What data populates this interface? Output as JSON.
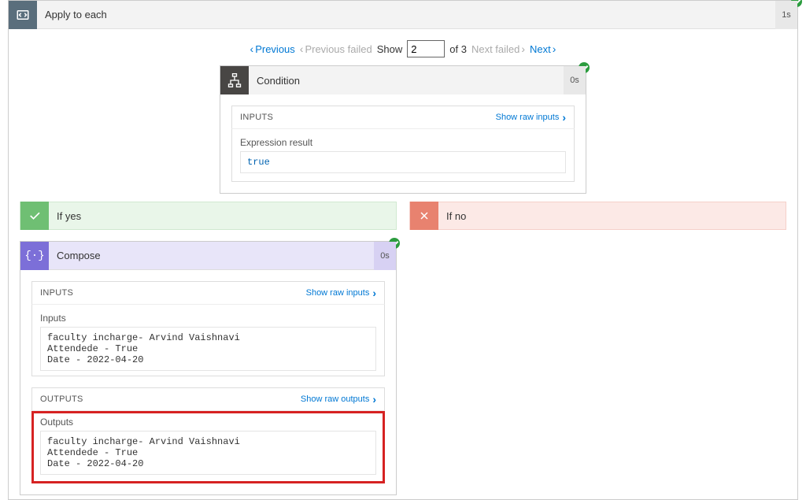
{
  "apply": {
    "title": "Apply to each",
    "duration": "1s"
  },
  "pager": {
    "previous": "Previous",
    "previousFailed": "Previous failed",
    "showLabel": "Show",
    "current": "2",
    "ofLabel": "of 3",
    "nextFailed": "Next failed",
    "next": "Next"
  },
  "condition": {
    "title": "Condition",
    "duration": "0s",
    "inputsLabel": "INPUTS",
    "showRawInputs": "Show raw inputs",
    "expressionResultLabel": "Expression result",
    "expressionResult": "true"
  },
  "branches": {
    "yes": {
      "title": "If yes"
    },
    "no": {
      "title": "If no"
    }
  },
  "compose": {
    "title": "Compose",
    "duration": "0s",
    "inputsHeader": "INPUTS",
    "showRawInputs": "Show raw inputs",
    "inputsLabel": "Inputs",
    "inputsText": "faculty incharge- Arvind Vaishnavi\nAttendede - True\nDate - 2022-04-20",
    "outputsHeader": "OUTPUTS",
    "showRawOutputs": "Show raw outputs",
    "outputsLabel": "Outputs",
    "outputsText": "faculty incharge- Arvind Vaishnavi\nAttendede - True\nDate - 2022-04-20"
  }
}
